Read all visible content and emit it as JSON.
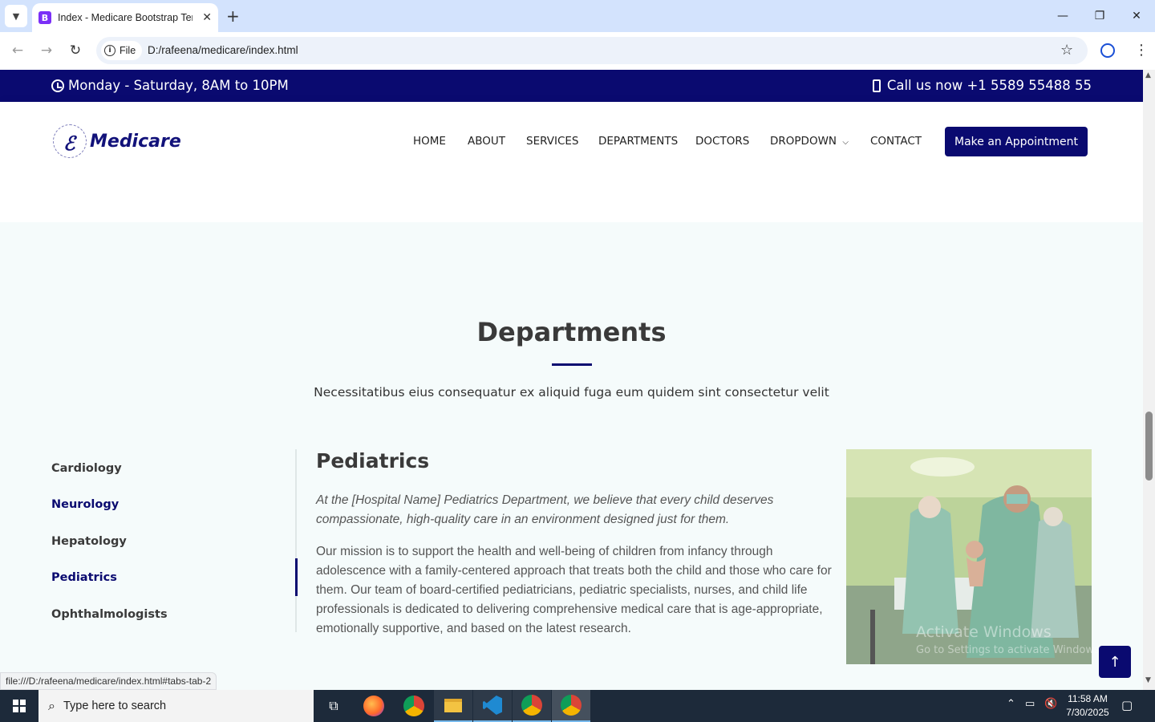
{
  "browser": {
    "tab_title": "Index - Medicare Bootstrap Template",
    "tab_favicon_letter": "B",
    "address_scheme": "File",
    "url": "D:/rafeena/medicare/index.html",
    "status_url": "file:///D:/rafeena/medicare/index.html#tabs-tab-2"
  },
  "topbar": {
    "hours": "Monday - Saturday, 8AM to 10PM",
    "phone": "Call us now +1 5589 55488 55"
  },
  "header": {
    "logo_text": "Medicare",
    "nav": [
      "HOME",
      "ABOUT",
      "SERVICES",
      "DEPARTMENTS",
      "DOCTORS",
      "DROPDOWN",
      "CONTACT"
    ],
    "cta": "Make an Appointment"
  },
  "departments": {
    "title": "Departments",
    "subtitle": "Necessitatibus eius consequatur ex aliquid fuga eum quidem sint consectetur velit",
    "tabs": [
      "Cardiology",
      "Neurology",
      "Hepatology",
      "Pediatrics",
      "Ophthalmologists"
    ],
    "active_tab": "Pediatrics",
    "content_title": "Pediatrics",
    "content_italic": "At the [Hospital Name] Pediatrics Department, we believe that every child deserves compassionate, high-quality care in an environment designed just for them.",
    "content_body": "Our mission is to support the health and well-being of children from infancy through adolescence with a family-centered approach that treats both the child and those who care for them. Our team of board-certified pediatricians, pediatric specialists, nurses, and child life professionals is dedicated to delivering comprehensive medical care that is age-appropriate, emotionally supportive, and based on the latest research."
  },
  "watermark": {
    "line1": "Activate Windows",
    "line2": "Go to Settings to activate Windows."
  },
  "taskbar": {
    "search_placeholder": "Type here to search",
    "time": "11:58 AM",
    "date": "7/30/2025"
  },
  "colors": {
    "brand": "#0a0a70",
    "page_bg": "#f5fbfb",
    "tab_strip": "#d3e3fd"
  }
}
